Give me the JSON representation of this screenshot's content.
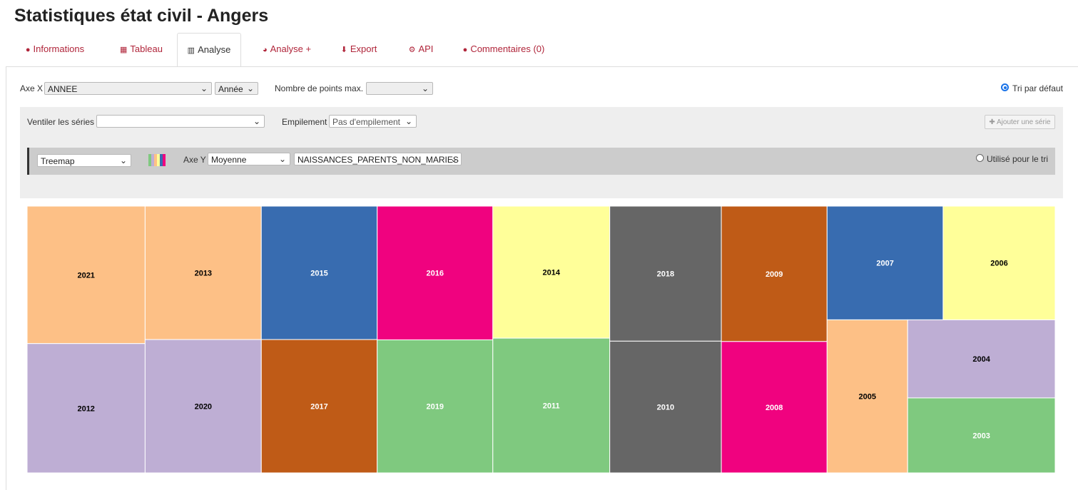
{
  "title": "Statistiques état civil - Angers",
  "tabs": [
    {
      "label": "Informations",
      "icon": "info-circle-icon"
    },
    {
      "label": "Tableau",
      "icon": "table-icon"
    },
    {
      "label": "Analyse",
      "icon": "bar-chart-icon"
    },
    {
      "label": "Analyse +",
      "icon": "pie-chart-icon"
    },
    {
      "label": "Export",
      "icon": "download-icon"
    },
    {
      "label": "API",
      "icon": "cogs-icon"
    },
    {
      "label": "Commentaires (0)",
      "icon": "comments-icon"
    }
  ],
  "controls": {
    "axe_x_label": "Axe X",
    "axe_x_value": "ANNEE",
    "axe_x_unit": "Année",
    "nb_points_label": "Nombre de points max.",
    "nb_points_value": "",
    "tri_label": "Tri par défaut",
    "ventiler_label": "Ventiler les séries",
    "ventiler_value": "",
    "empilement_label": "Empilement",
    "empilement_value": "Pas d'empilement",
    "ajouter_label": "Ajouter une série"
  },
  "serie": {
    "type": "Treemap",
    "axe_y_label": "Axe Y",
    "aggregation": "Moyenne",
    "field": "NAISSANCES_PARENTS_NON_MARIES",
    "tri_label": "Utilisé pour le tri",
    "palette": [
      "#7fc97f",
      "#beaed4",
      "#fdc086",
      "#ffff99",
      "#386cb0",
      "#f0027f"
    ]
  },
  "chart_data": {
    "type": "treemap",
    "series_field": "NAISSANCES_PARENTS_NON_MARIES",
    "categories": [
      "2021",
      "2012",
      "2013",
      "2020",
      "2015",
      "2017",
      "2016",
      "2019",
      "2014",
      "2011",
      "2018",
      "2010",
      "2009",
      "2008",
      "2007",
      "2006",
      "2005",
      "2004",
      "2003"
    ],
    "values": [
      1185,
      1115,
      1133,
      1132,
      1130,
      1129,
      1130,
      1124,
      1128,
      1151,
      1101,
      1074,
      1046,
      1015,
      964,
      931,
      901,
      842,
      808
    ],
    "colors": [
      "#fdc086",
      "#beaed4",
      "#fdc086",
      "#beaed4",
      "#386cb0",
      "#bf5b17",
      "#f0027f",
      "#7fc97f",
      "#ffff99",
      "#7fc97f",
      "#666666",
      "#666666",
      "#bf5b17",
      "#f0027f",
      "#386cb0",
      "#ffff99",
      "#fdc086",
      "#beaed4",
      "#7fc97f"
    ]
  }
}
